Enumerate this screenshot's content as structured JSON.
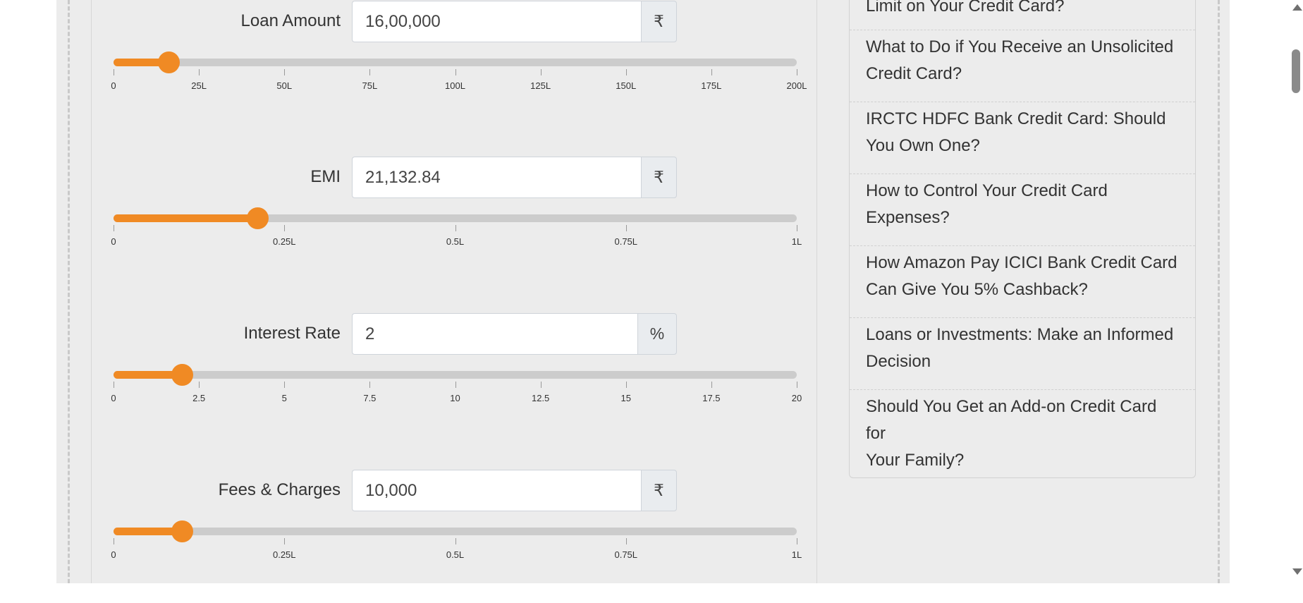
{
  "calculator": {
    "loan_amount": {
      "label": "Loan Amount",
      "value": "16,00,000",
      "unit": "₹",
      "slider_fraction": 0.08,
      "ticks": [
        "0",
        "25L",
        "50L",
        "75L",
        "100L",
        "125L",
        "150L",
        "175L",
        "200L"
      ]
    },
    "emi": {
      "label": "EMI",
      "value": "21,132.84",
      "unit": "₹",
      "slider_fraction": 0.211,
      "ticks": [
        "0",
        "0.25L",
        "0.5L",
        "0.75L",
        "1L"
      ]
    },
    "interest_rate": {
      "label": "Interest Rate",
      "value": "2",
      "unit": "%",
      "slider_fraction": 0.1,
      "ticks": [
        "0",
        "2.5",
        "5",
        "7.5",
        "10",
        "12.5",
        "15",
        "17.5",
        "20"
      ]
    },
    "fees_charges": {
      "label": "Fees & Charges",
      "value": "10,000",
      "unit": "₹",
      "slider_fraction": 0.1,
      "ticks": [
        "0",
        "0.25L",
        "0.5L",
        "0.75L",
        "1L"
      ]
    }
  },
  "sidebar": {
    "items": [
      {
        "label_lines": [
          "Limit on Your Credit Card?"
        ]
      },
      {
        "label_lines": [
          "What to Do if You Receive an Unsolicited",
          "Credit Card?"
        ]
      },
      {
        "label_lines": [
          "IRCTC HDFC Bank Credit Card: Should",
          "You Own One?"
        ]
      },
      {
        "label_lines": [
          "How to Control Your Credit Card",
          "Expenses?"
        ]
      },
      {
        "label_lines": [
          "How Amazon Pay ICICI Bank Credit Card",
          "Can Give You 5% Cashback?"
        ]
      },
      {
        "label_lines": [
          "Loans or Investments: Make an Informed",
          "Decision"
        ]
      },
      {
        "label_lines": [
          "Should You Get an Add-on Credit Card for",
          "Your Family?"
        ]
      }
    ]
  },
  "colors": {
    "accent": "#f08a24",
    "track": "#cccccc",
    "panel_bg": "#ececec"
  }
}
